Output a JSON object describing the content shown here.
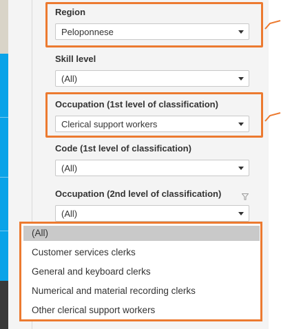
{
  "filters": {
    "region": {
      "label": "Region",
      "value": "Peloponnese"
    },
    "skill_level": {
      "label": "Skill level",
      "value": "(All)"
    },
    "occupation_1": {
      "label": "Occupation (1st level of classification)",
      "value": "Clerical support workers"
    },
    "code_1": {
      "label": "Code (1st level of classification)",
      "value": "(All)"
    },
    "occupation_2": {
      "label": "Occupation (2nd level of classification)",
      "value": "(All)"
    }
  },
  "dropdown": {
    "options": [
      "(All)",
      "Customer services clerks",
      "General and keyboard clerks",
      "Numerical and material recording clerks",
      "Other clerical support workers"
    ],
    "selected_index": 0
  },
  "icons": {
    "dropdown_caret": "caret-down-icon",
    "filter": "filter-icon",
    "annotation_arrow": "arrow-line-icon"
  },
  "colors": {
    "highlight": "#ec7a30",
    "sidebar_blue": "#0aa3e8",
    "sidebar_dark": "#3a3a3a",
    "sidebar_top": "#d9d4c8",
    "panel_bg": "#f4f4f4",
    "selected_option_bg": "#c9c9c9"
  }
}
